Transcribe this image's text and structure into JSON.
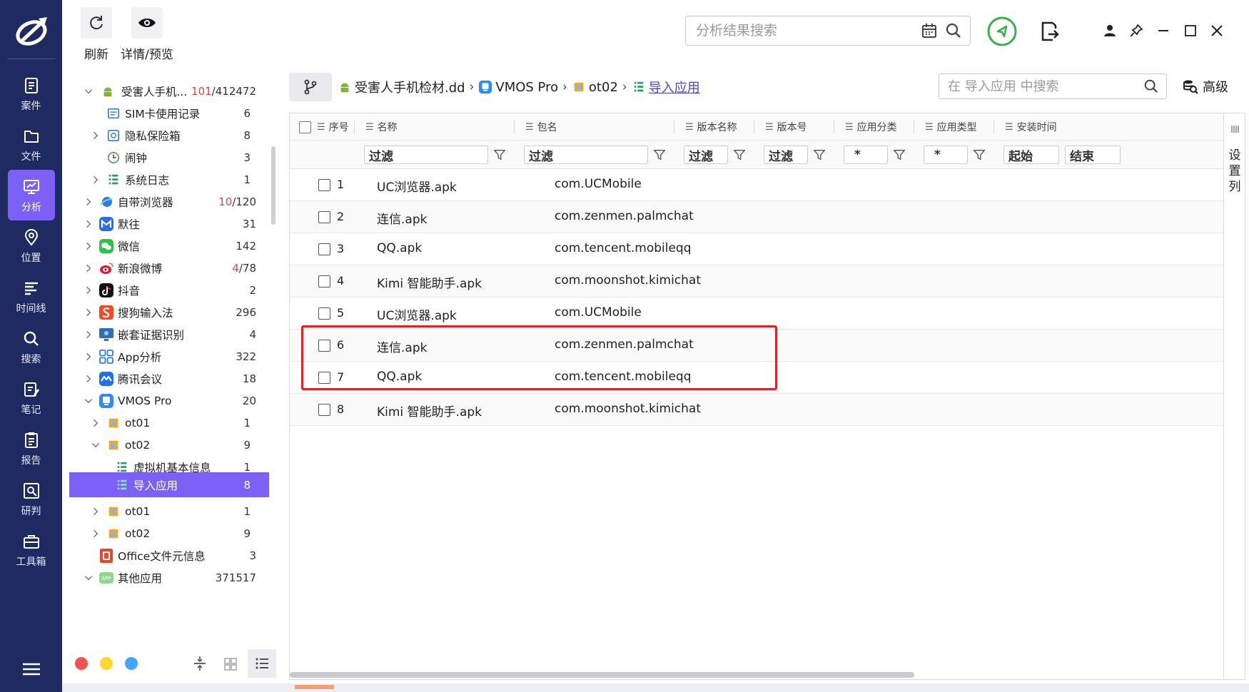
{
  "nav": {
    "items": [
      {
        "label": "案件",
        "icon": "case-icon"
      },
      {
        "label": "文件",
        "icon": "folder-icon"
      },
      {
        "label": "分析",
        "icon": "analysis-icon"
      },
      {
        "label": "位置",
        "icon": "location-icon"
      },
      {
        "label": "时间线",
        "icon": "timeline-icon"
      },
      {
        "label": "搜索",
        "icon": "search-icon"
      },
      {
        "label": "笔记",
        "icon": "note-icon"
      },
      {
        "label": "报告",
        "icon": "report-icon"
      },
      {
        "label": "研判",
        "icon": "judge-icon"
      },
      {
        "label": "工具箱",
        "icon": "toolbox-icon"
      }
    ],
    "active": "分析"
  },
  "toolbar": {
    "refresh_label": "刷新",
    "detail_label": "详情/预览",
    "search_placeholder": "分析结果搜索"
  },
  "tree": {
    "root_label": "受害人手机...",
    "root_count_red": "101",
    "root_count_total": "/412472",
    "items": [
      {
        "label": "SIM卡使用记录",
        "count": "6"
      },
      {
        "label": "隐私保险箱",
        "count": "8"
      },
      {
        "label": "闹钟",
        "count": "3"
      },
      {
        "label": "系统日志",
        "count": "1"
      },
      {
        "label": "自带浏览器",
        "count_red": "10",
        "count": "/120"
      },
      {
        "label": "默往",
        "count": "31"
      },
      {
        "label": "微信",
        "count": "142"
      },
      {
        "label": "新浪微博",
        "count_red": "4",
        "count": "/78"
      },
      {
        "label": "抖音",
        "count": "2"
      },
      {
        "label": "搜狗输入法",
        "count": "296"
      },
      {
        "label": "嵌套证据识别",
        "count": "4"
      },
      {
        "label": "App分析",
        "count": "322"
      },
      {
        "label": "腾讯会议",
        "count": "18"
      },
      {
        "label": "VMOS Pro",
        "count": "20"
      },
      {
        "label": "ot01",
        "count": "1"
      },
      {
        "label": "ot02",
        "count": "9"
      },
      {
        "label": "虚拟机基本信息",
        "count": "1"
      },
      {
        "label": "导入应用",
        "count": "8"
      },
      {
        "label": "ot01",
        "count": "1"
      },
      {
        "label": "ot02",
        "count": "9"
      },
      {
        "label": "Office文件元信息",
        "count": "3"
      },
      {
        "label": "其他应用",
        "count": "371517"
      }
    ]
  },
  "breadcrumb": [
    {
      "label": "受害人手机检材.dd"
    },
    {
      "label": "VMOS Pro"
    },
    {
      "label": "ot02"
    },
    {
      "label": "导入应用"
    }
  ],
  "panel": {
    "search_placeholder": "在 导入应用 中搜索",
    "advanced_label": "高级",
    "column_settings_label": "设置列"
  },
  "grid": {
    "columns": [
      "序号",
      "名称",
      "包名",
      "版本名称",
      "版本号",
      "应用分类",
      "应用类型",
      "安装时间"
    ],
    "filters": {
      "name": "过滤",
      "package": "过滤",
      "version_name": "过滤",
      "version_code": "过滤",
      "category": "*",
      "type": "*",
      "start": "起始",
      "end": "结束"
    },
    "rows": [
      {
        "num": "1",
        "name": "UC浏览器.apk",
        "pkg": "com.UCMobile"
      },
      {
        "num": "2",
        "name": "连信.apk",
        "pkg": "com.zenmen.palmchat"
      },
      {
        "num": "3",
        "name": "QQ.apk",
        "pkg": "com.tencent.mobileqq"
      },
      {
        "num": "4",
        "name": "Kimi 智能助手.apk",
        "pkg": "com.moonshot.kimichat"
      },
      {
        "num": "5",
        "name": "UC浏览器.apk",
        "pkg": "com.UCMobile"
      },
      {
        "num": "6",
        "name": "连信.apk",
        "pkg": "com.zenmen.palmchat"
      },
      {
        "num": "7",
        "name": "QQ.apk",
        "pkg": "com.tencent.mobileqq"
      },
      {
        "num": "8",
        "name": "Kimi 智能助手.apk",
        "pkg": "com.moonshot.kimichat"
      }
    ]
  },
  "colors": {
    "nav_bg": "#1f2a63",
    "accent": "#7b61f5",
    "highlight": "#e02424"
  }
}
